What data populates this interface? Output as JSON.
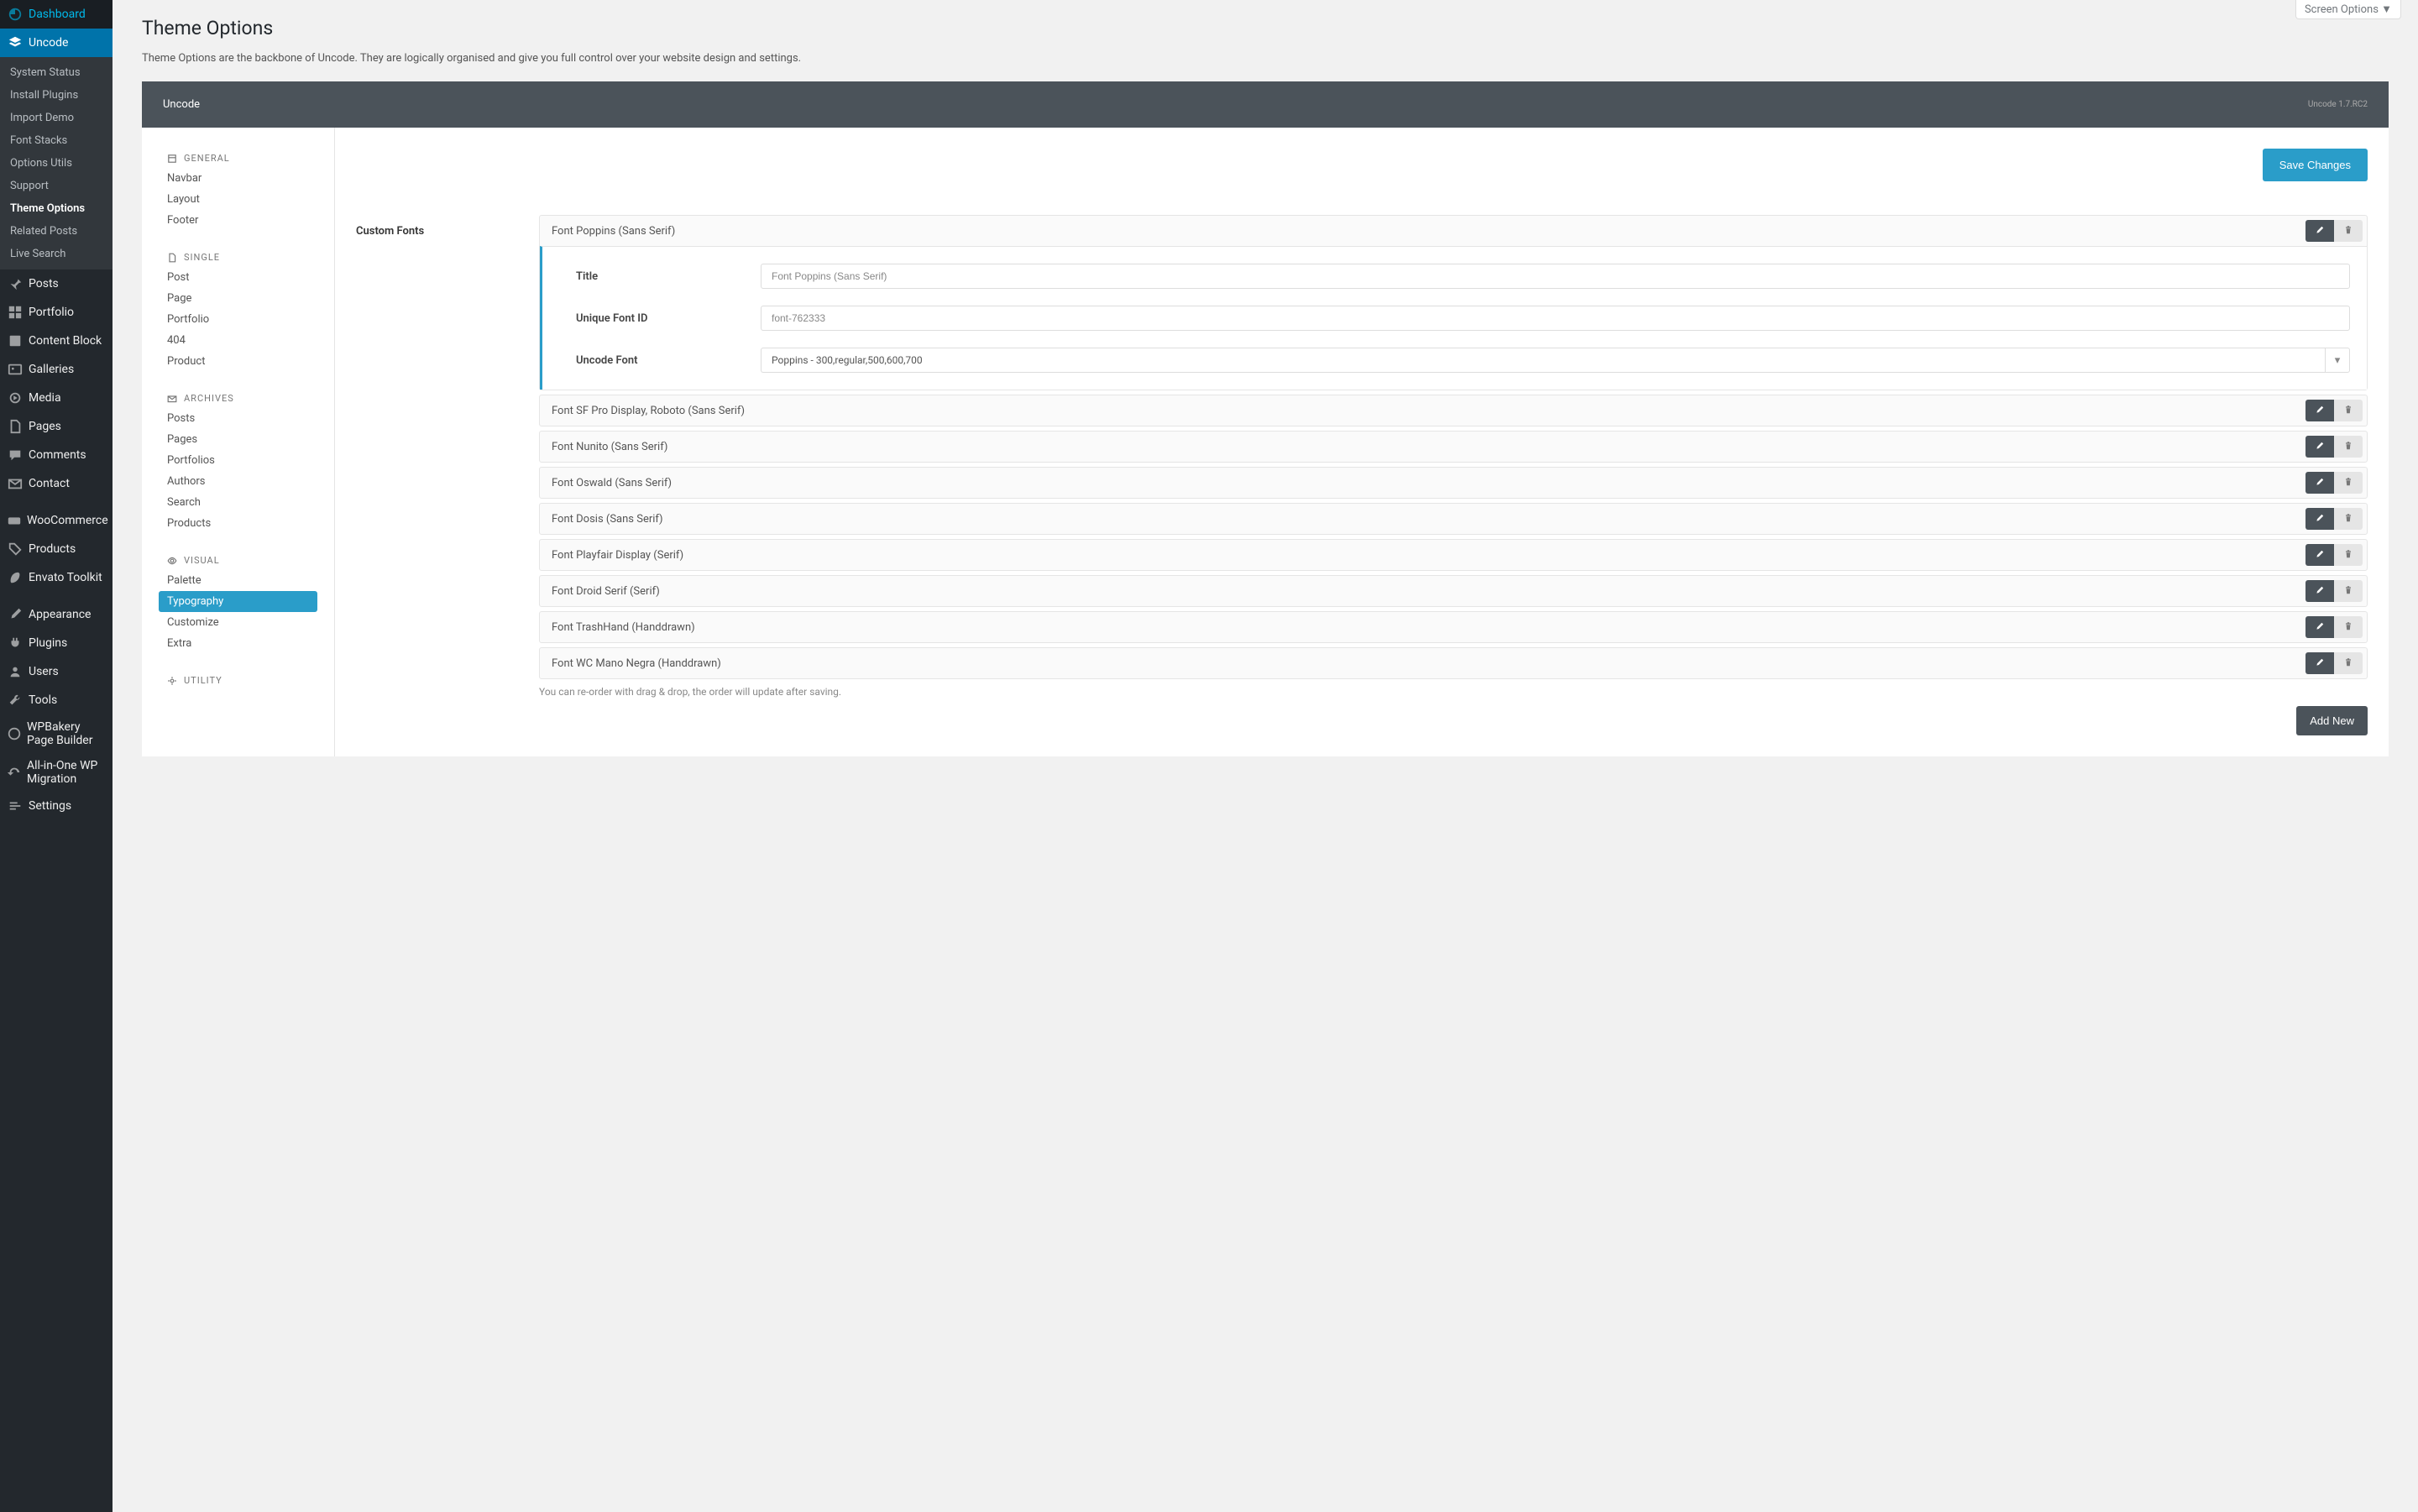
{
  "sidebar": {
    "dashboard": "Dashboard",
    "uncode": "Uncode",
    "posts": "Posts",
    "portfolio": "Portfolio",
    "content_block": "Content Block",
    "galleries": "Galleries",
    "media": "Media",
    "pages": "Pages",
    "comments": "Comments",
    "contact": "Contact",
    "woocommerce": "WooCommerce",
    "products": "Products",
    "envato": "Envato Toolkit",
    "appearance": "Appearance",
    "plugins": "Plugins",
    "users": "Users",
    "tools": "Tools",
    "wpbakery": "WPBakery Page Builder",
    "migration": "All-in-One WP Migration",
    "settings": "Settings"
  },
  "submenu": {
    "system_status": "System Status",
    "install_plugins": "Install Plugins",
    "import_demo": "Import Demo",
    "font_stacks": "Font Stacks",
    "options_utils": "Options Utils",
    "support": "Support",
    "theme_options": "Theme Options",
    "related_posts": "Related Posts",
    "live_search": "Live Search"
  },
  "screen_options": "Screen Options ▼",
  "page": {
    "title": "Theme Options",
    "desc": "Theme Options are the backbone of Uncode. They are logically organised and give you full control over your website design and settings."
  },
  "panel": {
    "title": "Uncode",
    "version": "Uncode 1.7.RC2",
    "save": "Save Changes"
  },
  "nav": {
    "general": "General",
    "navbar": "Navbar",
    "layout": "Layout",
    "footer": "Footer",
    "single": "Single",
    "post": "Post",
    "page": "Page",
    "portfolio": "Portfolio",
    "four04": "404",
    "product": "Product",
    "archives": "Archives",
    "arch_posts": "Posts",
    "arch_pages": "Pages",
    "arch_portfolios": "Portfolios",
    "arch_authors": "Authors",
    "arch_search": "Search",
    "arch_products": "Products",
    "visual": "Visual",
    "palette": "Palette",
    "typography": "Typography",
    "customize": "Customize",
    "extra": "Extra",
    "utility": "Utility"
  },
  "custom_fonts": "Custom Fonts",
  "fonts": [
    {
      "title": "Font Poppins (Sans Serif)",
      "expanded": true,
      "detail": {
        "title_label": "Title",
        "title_value": "Font Poppins (Sans Serif)",
        "id_label": "Unique Font ID",
        "id_value": "font-762333",
        "font_label": "Uncode Font",
        "font_value": "Poppins - 300,regular,500,600,700"
      }
    },
    {
      "title": "Font SF Pro Display, Roboto (Sans Serif)"
    },
    {
      "title": "Font Nunito (Sans Serif)"
    },
    {
      "title": "Font Oswald (Sans Serif)"
    },
    {
      "title": "Font Dosis (Sans Serif)"
    },
    {
      "title": "Font Playfair Display (Serif)"
    },
    {
      "title": "Font Droid Serif (Serif)"
    },
    {
      "title": "Font TrashHand (Handdrawn)"
    },
    {
      "title": "Font WC Mano Negra (Handdrawn)"
    }
  ],
  "reorder_note": "You can re-order with drag & drop, the order will update after saving.",
  "add_new": "Add New"
}
